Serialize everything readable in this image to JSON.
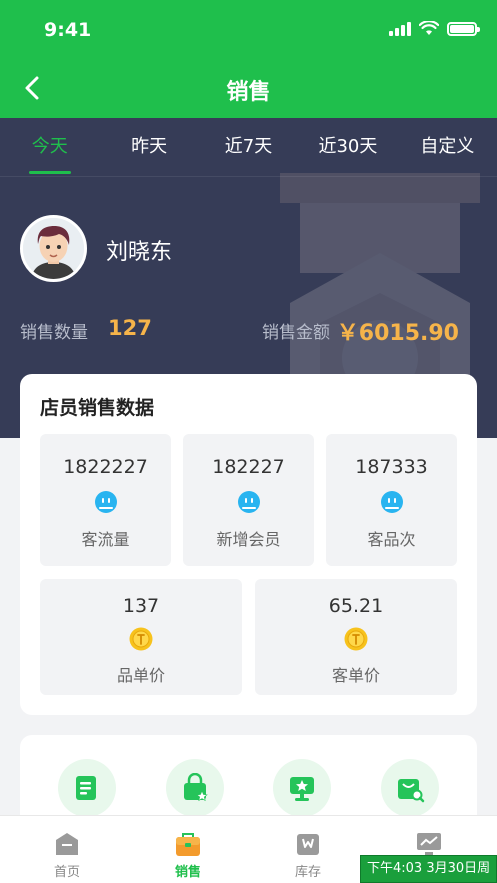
{
  "status": {
    "time": "9:41"
  },
  "nav": {
    "title": "销售"
  },
  "tabs": [
    {
      "label": "今天"
    },
    {
      "label": "昨天"
    },
    {
      "label": "近7天"
    },
    {
      "label": "近30天"
    },
    {
      "label": "自定义"
    }
  ],
  "user": {
    "name": "刘晓东"
  },
  "summary": {
    "count_label": "销售数量",
    "count_value": "127",
    "amount_label": "销售金额",
    "amount_value": "￥6015.90"
  },
  "staff_card": {
    "title": "店员销售数据",
    "stats": [
      {
        "value": "1822227",
        "label": "客流量",
        "icon": "face-icon"
      },
      {
        "value": "182227",
        "label": "新增会员",
        "icon": "face-icon"
      },
      {
        "value": "187333",
        "label": "客品次",
        "icon": "face-icon"
      },
      {
        "value": "137",
        "label": "品单价",
        "icon": "coin-icon"
      },
      {
        "value": "65.21",
        "label": "客单价",
        "icon": "coin-icon"
      }
    ]
  },
  "tabbar": [
    {
      "label": "首页",
      "icon": "home-icon"
    },
    {
      "label": "销售",
      "icon": "bag-icon"
    },
    {
      "label": "库存",
      "icon": "warehouse-icon"
    }
  ],
  "system_clock": "下午4:03  3月30日周",
  "colors": {
    "primary": "#1fbf4c",
    "hero": "#363c57",
    "accent": "#f6b44a",
    "blue": "#29b4f0"
  }
}
